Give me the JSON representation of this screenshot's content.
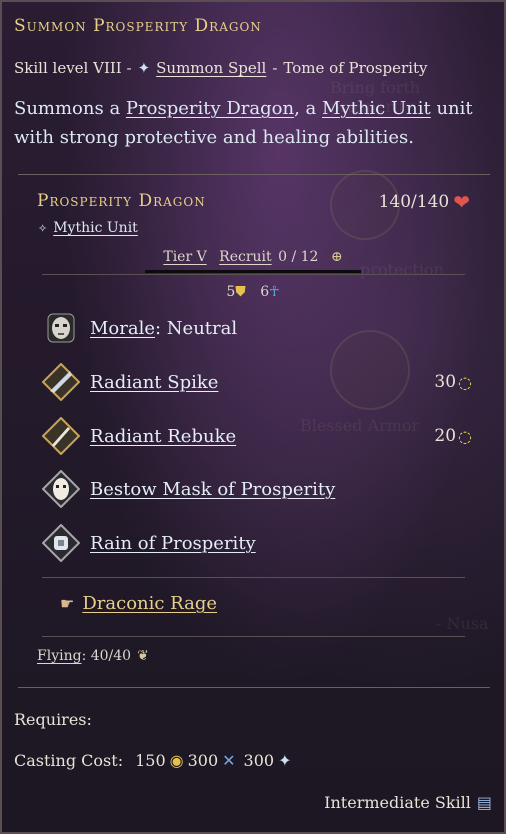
{
  "spell": {
    "title": "Summon Prosperity Dragon",
    "skill_level": "Skill level VIII -",
    "spell_type": "Summon Spell",
    "separator": "-",
    "tome": "Tome of Prosperity",
    "desc_prefix": "Summons a ",
    "desc_unit": "Prosperity Dragon",
    "desc_mid": ", a ",
    "desc_class": "Mythic Unit",
    "desc_suffix": " unit with strong protective and healing abilities."
  },
  "unit": {
    "name": "Prosperity Dragon",
    "hp": "140/140",
    "class": "Mythic Unit",
    "tier": "Tier V",
    "recruit_label": "Recruit",
    "recruit_value": "0 / 12",
    "defense": "5",
    "resistance": "6"
  },
  "abilities": [
    {
      "name": "Morale",
      "suffix": ": Neutral",
      "cost": ""
    },
    {
      "name": "Radiant Spike",
      "suffix": "",
      "cost": "30"
    },
    {
      "name": "Radiant Rebuke",
      "suffix": "",
      "cost": "20"
    },
    {
      "name": "Bestow Mask of Prosperity",
      "suffix": "",
      "cost": ""
    },
    {
      "name": "Rain of Prosperity",
      "suffix": "",
      "cost": ""
    }
  ],
  "passive": {
    "name": "Draconic Rage"
  },
  "movement": {
    "label": "Flying",
    "value": ": 40/40"
  },
  "requires_label": "Requires:",
  "casting_cost": {
    "label": "Casting Cost:",
    "gold": "150",
    "mana": "300",
    "imperium": "300"
  },
  "footer": "Intermediate Skill",
  "background_text": {
    "line1": "Bring forth prosperity",
    "line2": "protection",
    "line3": "Blessed Armor",
    "line4": "- Nusa"
  },
  "colors": {
    "title": "#e8cf8a",
    "link": "#dde8f2",
    "heart": "#e0554e",
    "gold": "#e6c24a",
    "mana": "#6fa8e6"
  }
}
